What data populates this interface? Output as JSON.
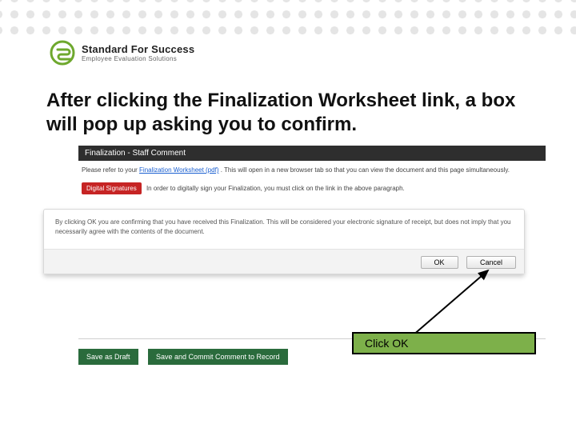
{
  "brand": {
    "name": "Standard For Success",
    "tagline": "Employee Evaluation Solutions"
  },
  "slide": {
    "title": "After clicking the Finalization Worksheet link, a box will pop up asking you to confirm."
  },
  "panel": {
    "header": "Finalization - Staff Comment",
    "refer_prefix": "Please refer to your ",
    "refer_link": "Finalization Worksheet (pdf)",
    "refer_suffix": ". This will open in a new browser tab so that you can view the document and this page simultaneously.",
    "sig_badge": "Digital Signatures",
    "sig_text": "In order to digitally sign your Finalization, you must click on the link in the above paragraph."
  },
  "modal": {
    "message": "By clicking OK you are confirming that you have received this Finalization. This will be considered your electronic signature of receipt, but does not imply that you necessarily agree with the contents of the document.",
    "ok_label": "OK",
    "cancel_label": "Cancel"
  },
  "page_buttons": {
    "draft": "Save as Draft",
    "commit": "Save and Commit Comment to Record"
  },
  "callout": {
    "text": "Click OK"
  }
}
